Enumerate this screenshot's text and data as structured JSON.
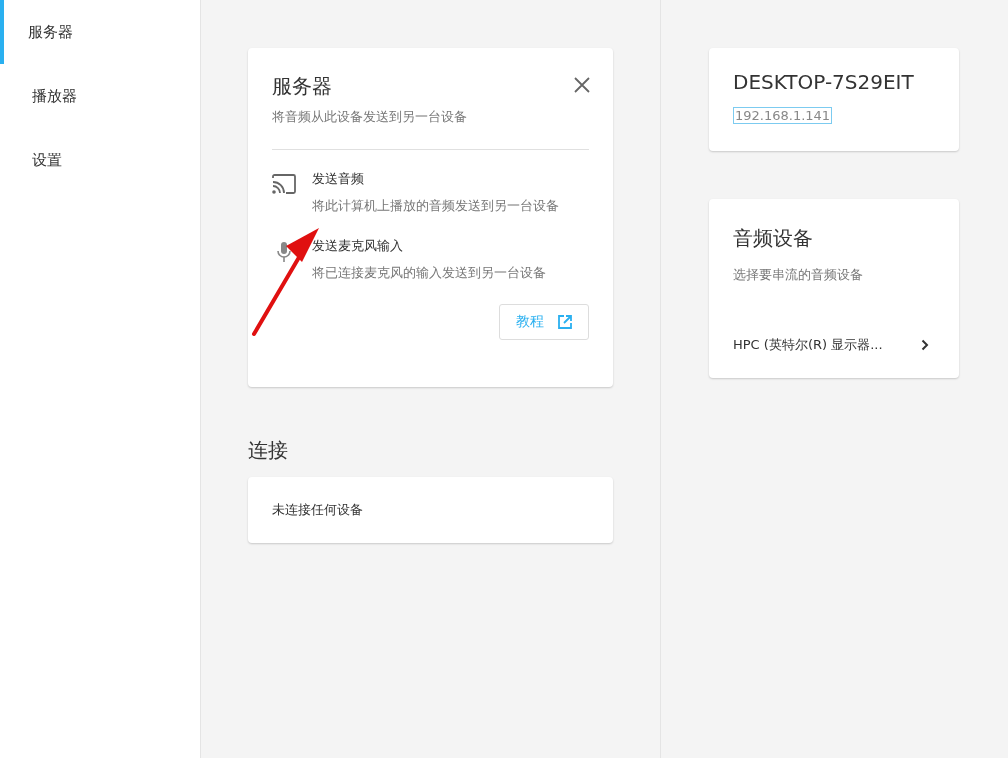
{
  "sidebar": {
    "items": [
      {
        "label": "服务器",
        "selected": true
      },
      {
        "label": "播放器",
        "selected": false
      },
      {
        "label": "设置",
        "selected": false
      }
    ]
  },
  "server_card": {
    "title": "服务器",
    "subtitle": "将音频从此设备发送到另一台设备",
    "options": [
      {
        "kind": "cast",
        "title": "发送音频",
        "description": "将此计算机上播放的音频发送到另一台设备"
      },
      {
        "kind": "mic",
        "title": "发送麦克风输入",
        "description": "将已连接麦克风的输入发送到另一台设备"
      }
    ],
    "tutorial_button": "教程"
  },
  "connections": {
    "heading": "连接",
    "status": "未连接任何设备"
  },
  "host": {
    "name": "DESKTOP-7S29EIT",
    "ip": "192.168.1.141",
    "ip_focused": true
  },
  "audio_devices": {
    "title": "音频设备",
    "subtitle": "选择要串流的音频设备",
    "device": "HPC (英特尔(R) 显示器..."
  }
}
